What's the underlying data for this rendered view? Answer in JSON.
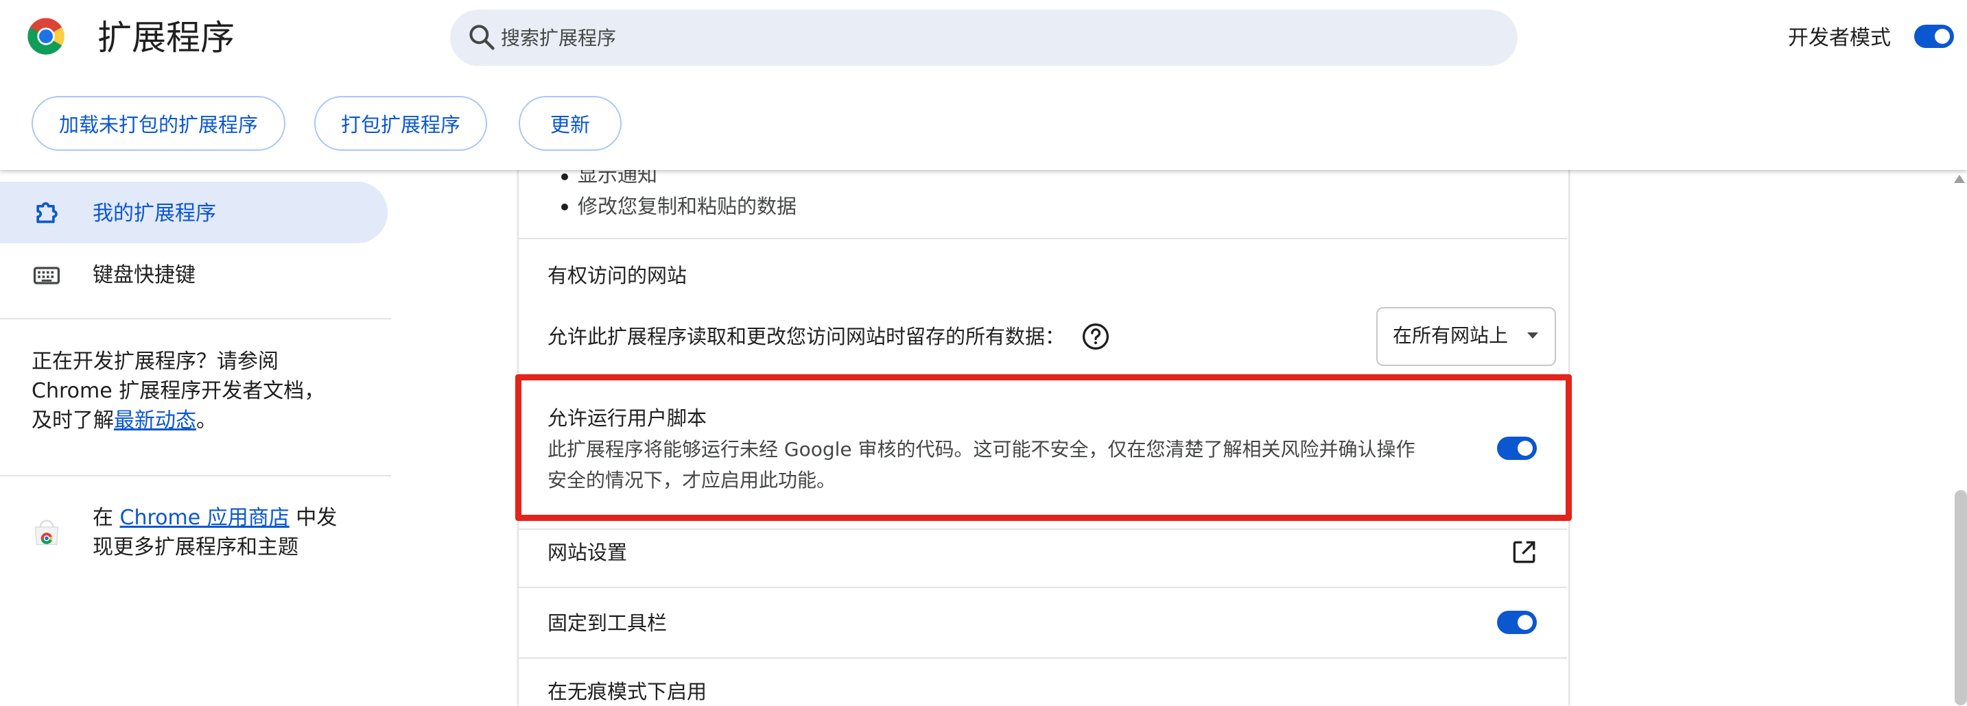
{
  "header": {
    "title": "扩展程序",
    "search_placeholder": "搜索扩展程序",
    "dev_mode_label": "开发者模式",
    "dev_mode_on": true,
    "buttons": {
      "load_unpacked": "加载未打包的扩展程序",
      "pack": "打包扩展程序",
      "update": "更新"
    }
  },
  "sidebar": {
    "items": [
      {
        "label": "我的扩展程序",
        "icon": "puzzle-icon",
        "active": true
      },
      {
        "label": "键盘快捷键",
        "icon": "keyboard-icon",
        "active": false
      }
    ],
    "dev_note": {
      "line1": "正在开发扩展程序？请参阅",
      "line2": "Chrome 扩展程序开发者文档，",
      "line3_prefix": "及时了解",
      "link": "最新动态",
      "line3_suffix": "。"
    },
    "store": {
      "prefix": "在 ",
      "link": "Chrome 应用商店",
      "suffix_line1": " 中发",
      "line2": "现更多扩展程序和主题"
    }
  },
  "details": {
    "permissions": [
      "显示通知",
      "修改您复制和粘贴的数据"
    ],
    "site_access_heading": "有权访问的网站",
    "site_access_label": "允许此扩展程序读取和更改您访问网站时留存的所有数据：",
    "site_access_value": "在所有网站上",
    "user_scripts": {
      "title": "允许运行用户脚本",
      "desc_line1": "此扩展程序将能够运行未经 Google 审核的代码。这可能不安全，仅在您清楚了解相关风险并确认操作",
      "desc_line2": "安全的情况下，才应启用此功能。",
      "enabled": true
    },
    "site_settings": "网站设置",
    "pin_toolbar": "固定到工具栏",
    "pin_enabled": true,
    "incognito": "在无痕模式下启用"
  },
  "colors": {
    "accent": "#0b57d0",
    "highlight_border": "#e3241b",
    "active_nav_bg": "#e2e9f9",
    "search_bg": "#e9eef6"
  }
}
